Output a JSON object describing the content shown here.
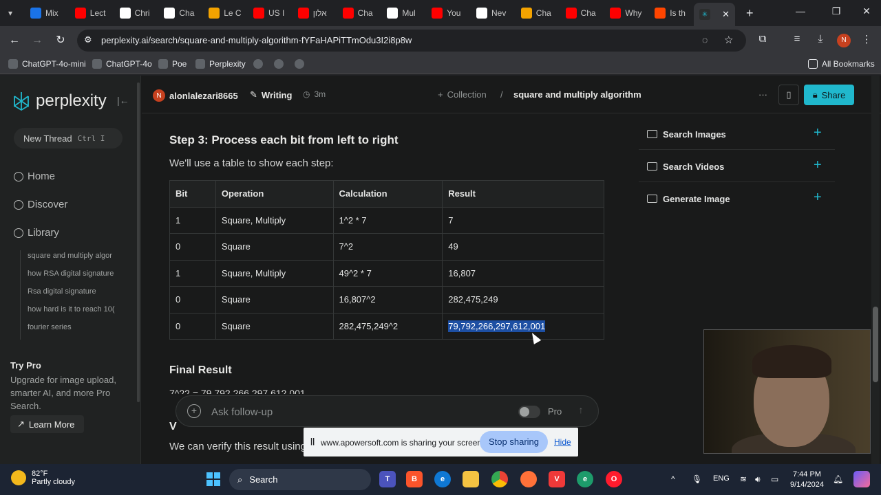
{
  "browser": {
    "tabs": [
      {
        "label": "Mix",
        "color": "#1a73e8"
      },
      {
        "label": "Lect",
        "color": "#ff0000"
      },
      {
        "label": "Chri",
        "color": "#ffffff"
      },
      {
        "label": "Cha",
        "color": "#ffffff"
      },
      {
        "label": "Le C",
        "color": "#f4a300"
      },
      {
        "label": "US I",
        "color": "#ff0000"
      },
      {
        "label": "אלון",
        "color": "#ff0000"
      },
      {
        "label": "Cha",
        "color": "#ff0000"
      },
      {
        "label": "Mul",
        "color": "#ffffff"
      },
      {
        "label": "You",
        "color": "#ff0000"
      },
      {
        "label": "Nev",
        "color": "#ffffff"
      },
      {
        "label": "Cha",
        "color": "#f4a300"
      },
      {
        "label": "Cha",
        "color": "#ff0000"
      },
      {
        "label": "Why",
        "color": "#ff0000"
      },
      {
        "label": "Is th",
        "color": "#ff4500"
      }
    ],
    "url": "perplexity.ai/search/square-and-multiply-algorithm-fYFaHAPiTTmOdu3I2i8p8w",
    "bookmarks": [
      "ChatGPT-4o-mini",
      "ChatGPT-4o",
      "Poe",
      "Perplexity"
    ],
    "all_bookmarks": "All Bookmarks",
    "profile_initial": "N"
  },
  "sidebar": {
    "logo": "perplexity",
    "new_thread": "New Thread",
    "shortcut": "Ctrl  I",
    "nav": [
      "Home",
      "Discover",
      "Library"
    ],
    "library": [
      "square and multiply algor",
      "how RSA digital signature",
      "Rsa digital signature",
      "how hard is it to reach 10(",
      "fourier series"
    ],
    "try_pro_title": "Try Pro",
    "try_pro_text": "Upgrade for image upload, smarter AI, and more Pro Search.",
    "learn_more": "Learn More"
  },
  "header": {
    "user": "alonlalezari8665",
    "user_initial": "N",
    "mode": "Writing",
    "time": "3m",
    "collection": "Collection",
    "separator": "/",
    "thread_title": "square and multiply algorithm",
    "more": "···",
    "share": "Share"
  },
  "content": {
    "step_heading": "Step 3: Process each bit from left to right",
    "intro": "We'll use a table to show each step:",
    "table": {
      "headers": [
        "Bit",
        "Operation",
        "Calculation",
        "Result"
      ],
      "rows": [
        [
          "1",
          "Square, Multiply",
          "1^2 * 7",
          "7"
        ],
        [
          "0",
          "Square",
          "7^2",
          "49"
        ],
        [
          "1",
          "Square, Multiply",
          "49^2 * 7",
          "16,807"
        ],
        [
          "0",
          "Square",
          "16,807^2",
          "282,475,249"
        ],
        [
          "0",
          "Square",
          "282,475,249^2",
          "79,792,266,297,612,001"
        ]
      ]
    },
    "final_heading": "Final Result",
    "final_eq": "7^22 = 79,792,266,297,612,001",
    "verify_heading": "V",
    "verify_text": "We can verify this result using precision arithmetic."
  },
  "ask": {
    "placeholder": "Ask follow-up",
    "pro": "Pro"
  },
  "right_panel": [
    "Search Images",
    "Search Videos",
    "Generate Image"
  ],
  "share_banner": {
    "message": "www.apowersoft.com is sharing your screen.",
    "stop": "Stop sharing",
    "hide": "Hide"
  },
  "taskbar": {
    "temp": "82°F",
    "weather": "Partly cloudy",
    "search": "Search",
    "lang": "ENG",
    "time": "7:44 PM",
    "date": "9/14/2024"
  }
}
